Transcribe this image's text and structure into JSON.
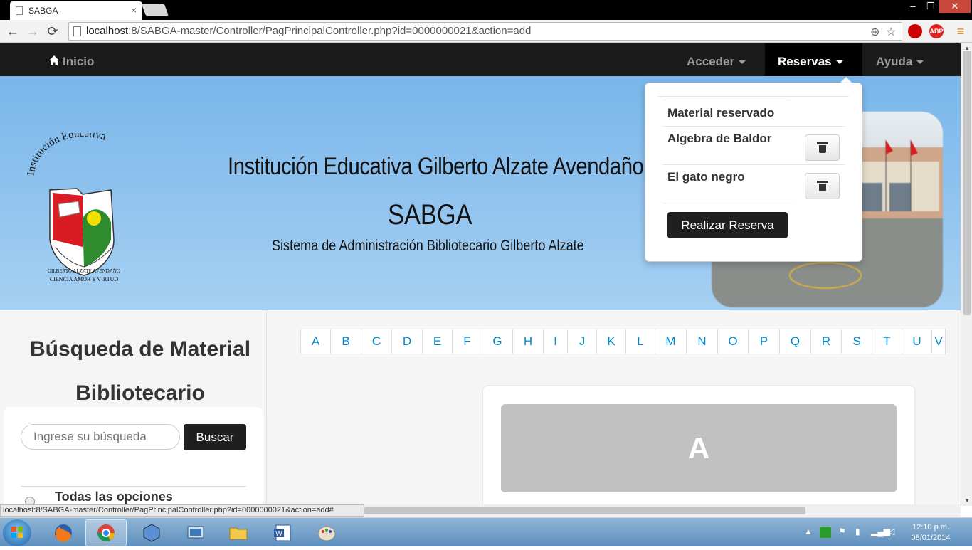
{
  "browser": {
    "tab_title": "SABGA",
    "tab_close": "×",
    "url_host": "localhost",
    "url_rest": ":8/SABGA-master/Controller/PagPrincipalController.php?id=0000000021&action=add",
    "status_url": "localhost:8/SABGA-master/Controller/PagPrincipalController.php?id=0000000021&action=add#",
    "back": "←",
    "forward": "→",
    "reload": "⟳",
    "zoom_icon": "⊕",
    "star_icon": "☆",
    "ext1": "",
    "ext2": "ABP",
    "menu": "≡",
    "min": "‒",
    "max": "❐",
    "close": "✕"
  },
  "navbar": {
    "home_label": "Inicio",
    "acceder_label": "Acceder",
    "reservas_label": "Reservas",
    "ayuda_label": "Ayuda"
  },
  "banner": {
    "title": "Institución Educativa Gilberto Alzate Avendaño",
    "acronym": "SABGA",
    "subtitle": "Sistema de Administración Bibliotecario Gilberto Alzate",
    "logo_top": "Institución Educativa",
    "logo_arc": "GILBERTO ALZATE AVENDAÑO",
    "logo_motto": "CIENCIA AMOR Y VIRTUD"
  },
  "sidebar": {
    "title_line1": "Búsqueda de Material",
    "title_line2": "Bibliotecario",
    "search_placeholder": "Ingrese su búsqueda",
    "search_button": "Buscar",
    "option_all": "Todas las opciones"
  },
  "pager": {
    "letters": [
      "A",
      "B",
      "C",
      "D",
      "E",
      "F",
      "G",
      "H",
      "I",
      "J",
      "K",
      "L",
      "M",
      "N",
      "O",
      "P",
      "Q",
      "R",
      "S",
      "T",
      "U",
      "V"
    ]
  },
  "main": {
    "current_letter": "A"
  },
  "reservas_menu": {
    "header": "Material reservado",
    "items": [
      {
        "title": "Algebra de Baldor"
      },
      {
        "title": "El gato negro"
      }
    ],
    "submit_label": "Realizar Reserva"
  },
  "taskbar": {
    "time": "12:10 p.m.",
    "date": "08/01/2014",
    "apps": [
      "firefox-icon",
      "chrome-icon",
      "virtualbox-icon",
      "control-panel-icon",
      "file-explorer-icon",
      "word-icon",
      "paint-icon"
    ]
  },
  "colors": {
    "navbar_bg": "#1b1b1b",
    "banner_top": "#79b6ea",
    "link": "#0088cc",
    "letter_box": "#c1c1c1",
    "dark_button": "#1f1f1f"
  }
}
